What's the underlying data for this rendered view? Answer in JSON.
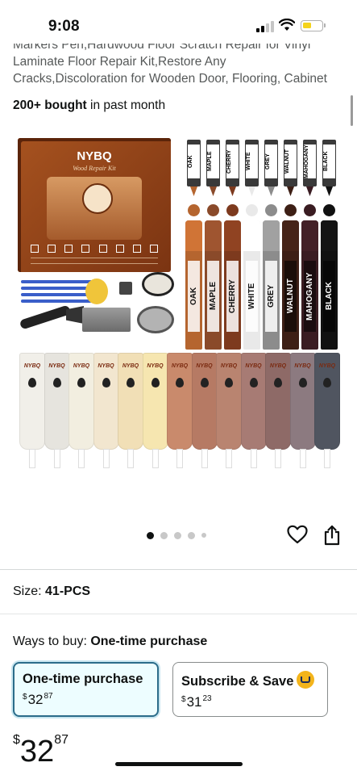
{
  "status_bar": {
    "time": "9:08"
  },
  "product": {
    "title": "Markers Pen,Hardwood Floor Scratch Repair for Vinyl Laminate Floor Repair Kit,Restore Any Cracks,Discoloration for Wooden Door, Flooring, Cabinet",
    "bought_count": "200+ bought",
    "bought_suffix": " in past month",
    "image": {
      "brand": "NYBQ",
      "box_subtitle": "Wood Repair Kit",
      "markers": [
        {
          "label": "OAK",
          "color": "#b5652f"
        },
        {
          "label": "MAPLE",
          "color": "#8a4a2a"
        },
        {
          "label": "CHERRY",
          "color": "#7d3a1e"
        },
        {
          "label": "WHITE",
          "color": "#e9e9e9"
        },
        {
          "label": "GREY",
          "color": "#8c8c8c"
        },
        {
          "label": "WALNUT",
          "color": "#3d1f15"
        },
        {
          "label": "MAHOGANY",
          "color": "#3a1c22"
        },
        {
          "label": "BLACK",
          "color": "#111111"
        }
      ],
      "tube_colors": [
        "#f1efe9",
        "#e6e4de",
        "#f2eee0",
        "#f2e6cf",
        "#f1dfb6",
        "#f6e6b0",
        "#c98a6c",
        "#b67a64",
        "#b98470",
        "#a77b74",
        "#8e6a67",
        "#8c7a80",
        "#505560"
      ]
    }
  },
  "gallery": {
    "dot_count": 5,
    "active_index": 0
  },
  "size": {
    "label": "Size: ",
    "value": "41-PCS"
  },
  "ways_to_buy": {
    "label": "Ways to buy: ",
    "value": "One-time purchase"
  },
  "options": [
    {
      "title": "One-time purchase",
      "currency": "$",
      "whole": "32",
      "fraction": "87"
    },
    {
      "title": "Subscribe & Save",
      "currency": "$",
      "whole": "31",
      "fraction": "23"
    }
  ],
  "price": {
    "currency": "$",
    "whole": "32",
    "fraction": "87"
  },
  "colors": {
    "selected_border": "#2b6c8a",
    "selected_bg": "#edfdff",
    "text": "#0f1111",
    "muted": "#565959"
  }
}
